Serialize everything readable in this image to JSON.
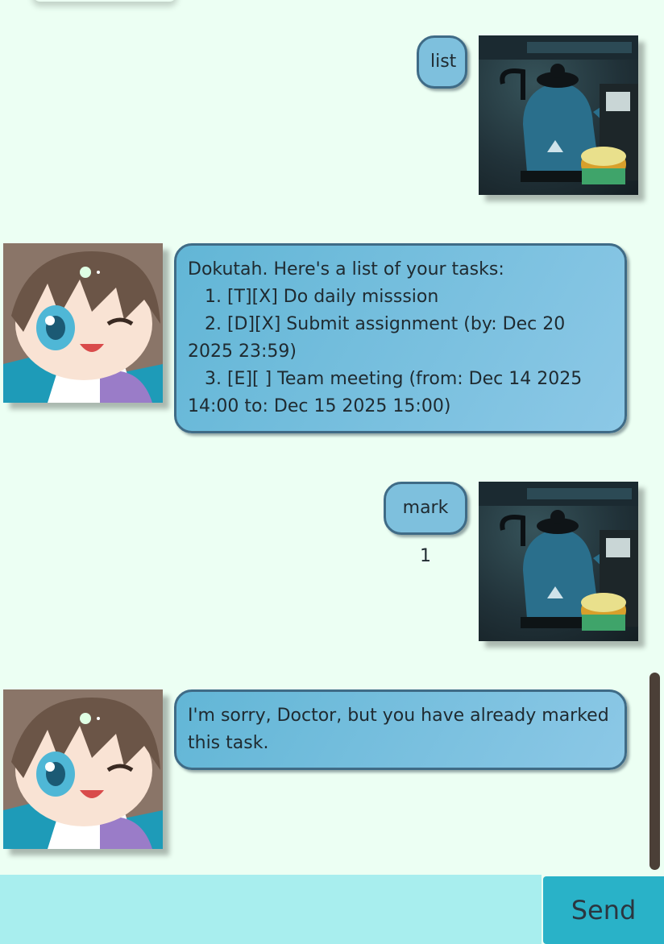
{
  "messages": [
    {
      "sender": "user",
      "text": "list"
    },
    {
      "sender": "duke",
      "text": "Dokutah. Here's a list of your tasks:\n   1. [T][X] Do daily misssion\n   2. [D][X] Submit assignment (by: Dec 20 2025 23:59)\n   3. [E][ ] Team meeting (from: Dec 14 2025 14:00 to: Dec 15 2025 15:00)"
    },
    {
      "sender": "user",
      "text": "mark 1"
    },
    {
      "sender": "duke",
      "text": "I'm sorry, Doctor, but you have already marked this task."
    }
  ],
  "input": {
    "value": "",
    "placeholder": ""
  },
  "send_button": {
    "label": "Send"
  },
  "icons": {
    "user_avatar": "kettle-photo-icon",
    "duke_avatar": "chibi-girl-avatar-icon"
  },
  "colors": {
    "background": "#ecfff3",
    "bubble_border": "#3f6b86",
    "user_bubble": "#7ec0dd",
    "duke_bubble": "#73bfe0",
    "input_bg": "#a8eeee",
    "send_bg": "#29b2c8",
    "scrollbar": "#4b3f37"
  }
}
